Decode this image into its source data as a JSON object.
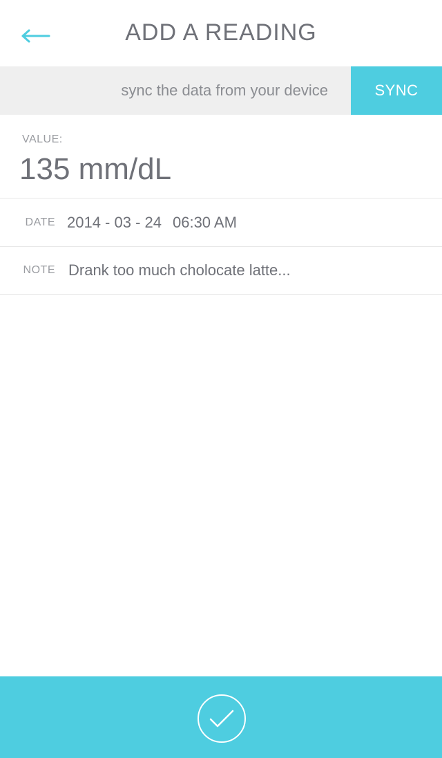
{
  "header": {
    "title": "ADD A READING",
    "back_icon": "arrow-left-icon"
  },
  "sync": {
    "hint": "sync the data from your device",
    "button_label": "SYNC"
  },
  "reading": {
    "value_label": "VALUE:",
    "value": "135 mm/dL"
  },
  "date_row": {
    "label": "DATE",
    "date": "2014 - 03 - 24",
    "time": "06:30 AM"
  },
  "note_row": {
    "label": "NOTE",
    "value": "Drank too much cholocate latte..."
  },
  "footer": {
    "confirm_icon": "checkmark-icon"
  },
  "colors": {
    "accent": "#4ecde0",
    "text": "#6f7178",
    "muted": "#9a9ca1",
    "bar_bg": "#efefef"
  }
}
